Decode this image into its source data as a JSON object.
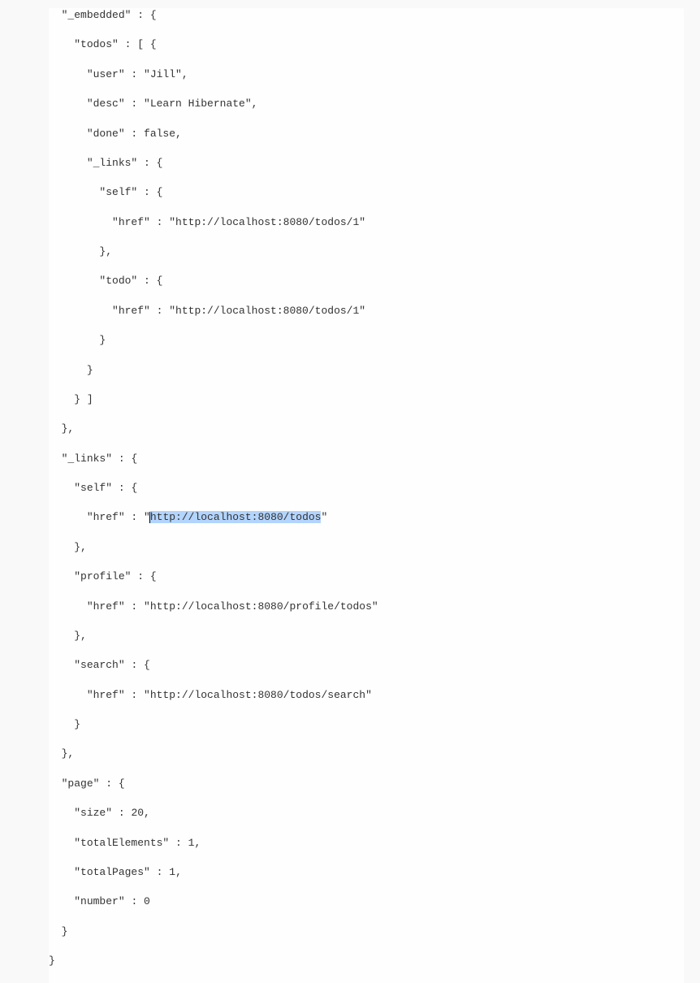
{
  "json_response": {
    "_embedded": {
      "todos": [
        {
          "user": "Jill",
          "desc": "Learn Hibernate",
          "done": false,
          "_links": {
            "self": {
              "href": "http://localhost:8080/todos/1"
            },
            "todo": {
              "href": "http://localhost:8080/todos/1"
            }
          }
        }
      ]
    },
    "_links": {
      "self": {
        "href": "http://localhost:8080/todos"
      },
      "profile": {
        "href": "http://localhost:8080/profile/todos"
      },
      "search": {
        "href": "http://localhost:8080/todos/search"
      }
    },
    "page": {
      "size": 20,
      "totalElements": 1,
      "totalPages": 1,
      "number": 0
    }
  },
  "selected_text": "http://localhost:8080/todos",
  "labels": {
    "embedded_key": "\"_embedded\"",
    "todos_key": "\"todos\"",
    "user_key": "\"user\"",
    "desc_key": "\"desc\"",
    "done_key": "\"done\"",
    "links_key": "\"_links\"",
    "self_key": "\"self\"",
    "href_key": "\"href\"",
    "todo_key": "\"todo\"",
    "profile_key": "\"profile\"",
    "search_key": "\"search\"",
    "page_key": "\"page\"",
    "size_key": "\"size\"",
    "totalElements_key": "\"totalElements\"",
    "totalPages_key": "\"totalPages\"",
    "number_key": "\"number\"",
    "user_val": "\"Jill\"",
    "desc_val": "\"Learn Hibernate\"",
    "done_val": "false",
    "href_todos1": "\"http://localhost:8080/todos/1\"",
    "href_profile": "\"http://localhost:8080/profile/todos\"",
    "href_search": "\"http://localhost:8080/todos/search\"",
    "size_val": "20",
    "totalElements_val": "1",
    "totalPages_val": "1",
    "number_val": "0",
    "quote_open": "\"",
    "quote_close": "\"",
    "open_brace": "{",
    "close_brace": "}",
    "open_bracket_brace": "[ {",
    "close_bracket_brace": "} ]",
    "comma": ",",
    "colon": " : "
  }
}
